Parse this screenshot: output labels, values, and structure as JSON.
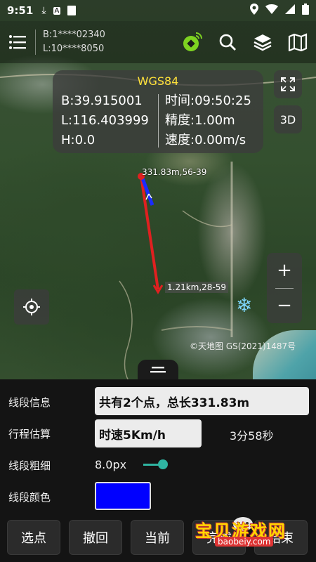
{
  "status_bar": {
    "time": "9:51",
    "icons": [
      "download-icon",
      "app-a-icon",
      "file-icon",
      "location-icon",
      "wifi-icon",
      "signal-icon",
      "battery-icon"
    ]
  },
  "toolbar": {
    "coord_b": "B:1****02340",
    "coord_l": "L:10****8050",
    "icons": [
      "menu-icon",
      "gps-satellite-icon",
      "search-icon",
      "layers-icon",
      "map-icon"
    ],
    "gps_color": "#7ed321"
  },
  "info_panel": {
    "datum": "WGS84",
    "lat": "B:39.915001",
    "lon": "L:116.403999",
    "height": "H:0.0",
    "time": "时间:09:50:25",
    "accuracy": "精度:1.00m",
    "speed": "速度:0.00m/s"
  },
  "map": {
    "point_label_1": "331.83m,56-39",
    "point_label_2": "1.21km,28-59",
    "attribution": "©天地图 GS(2021)1487号",
    "track_color": "#e02020",
    "segment_color": "#1a2cff",
    "btn_3d": "3D",
    "zoom_in": "+",
    "zoom_out": "−"
  },
  "bottom_panel": {
    "segment_info_label": "线段信息",
    "segment_info_value": "共有2个点，总长331.83m",
    "estimate_label": "行程估算",
    "speed_value": "时速5Km/h",
    "duration": "3分58秒",
    "thickness_label": "线段粗细",
    "thickness_value": "8.0px",
    "color_label": "线段颜色",
    "line_color": "#0000ff",
    "buttons": [
      "选点",
      "撤回",
      "当前",
      "完成",
      "结束"
    ]
  },
  "watermark": {
    "title": "宝贝游戏网",
    "url": "baobeiy.com"
  }
}
